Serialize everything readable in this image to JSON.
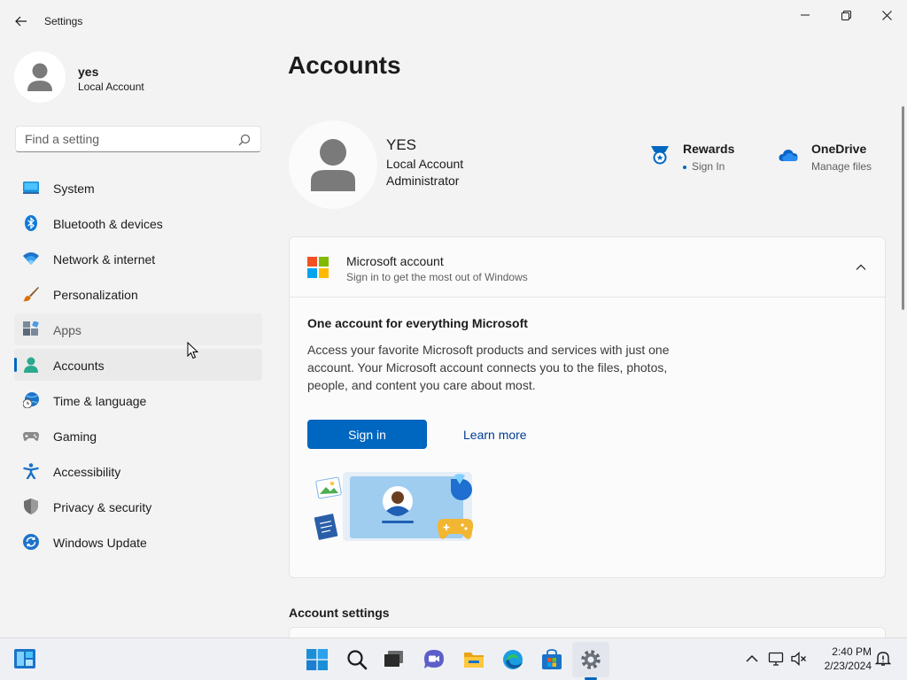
{
  "window": {
    "title": "Settings"
  },
  "sidebar": {
    "profile": {
      "name": "yes",
      "account_type": "Local Account"
    },
    "search": {
      "placeholder": "Find a setting",
      "value": ""
    },
    "items": [
      {
        "label": "System",
        "icon": "monitor-icon"
      },
      {
        "label": "Bluetooth & devices",
        "icon": "bluetooth-icon"
      },
      {
        "label": "Network & internet",
        "icon": "wifi-icon"
      },
      {
        "label": "Personalization",
        "icon": "brush-icon"
      },
      {
        "label": "Apps",
        "icon": "apps-icon",
        "state": "hover"
      },
      {
        "label": "Accounts",
        "icon": "person-icon",
        "state": "selected"
      },
      {
        "label": "Time & language",
        "icon": "globe-clock-icon"
      },
      {
        "label": "Gaming",
        "icon": "gamepad-icon"
      },
      {
        "label": "Accessibility",
        "icon": "accessibility-icon"
      },
      {
        "label": "Privacy & security",
        "icon": "shield-icon"
      },
      {
        "label": "Windows Update",
        "icon": "update-icon"
      }
    ]
  },
  "main": {
    "page_title": "Accounts",
    "user": {
      "name": "YES",
      "line1": "Local Account",
      "line2": "Administrator"
    },
    "rewards": {
      "title": "Rewards",
      "subtitle": "Sign In"
    },
    "onedrive": {
      "title": "OneDrive",
      "subtitle": "Manage files"
    },
    "ms_account_card": {
      "title": "Microsoft account",
      "subtitle": "Sign in to get the most out of Windows",
      "promo_title": "One account for everything Microsoft",
      "promo_body": "Access your favorite Microsoft products and services with just one account. Your Microsoft account connects you to the files, photos, people, and content you care about most.",
      "signin_label": "Sign in",
      "learn_more_label": "Learn more"
    },
    "account_settings_heading": "Account settings"
  },
  "taskbar": {
    "time": "2:40 PM",
    "date": "2/23/2024",
    "apps": [
      "start-icon",
      "search-icon",
      "task-view-icon",
      "chat-icon",
      "file-explorer-icon",
      "edge-icon",
      "store-icon",
      "settings-icon"
    ]
  },
  "colors": {
    "accent": "#0067c0",
    "background": "#f3f3f3",
    "card": "#fbfbfb"
  }
}
